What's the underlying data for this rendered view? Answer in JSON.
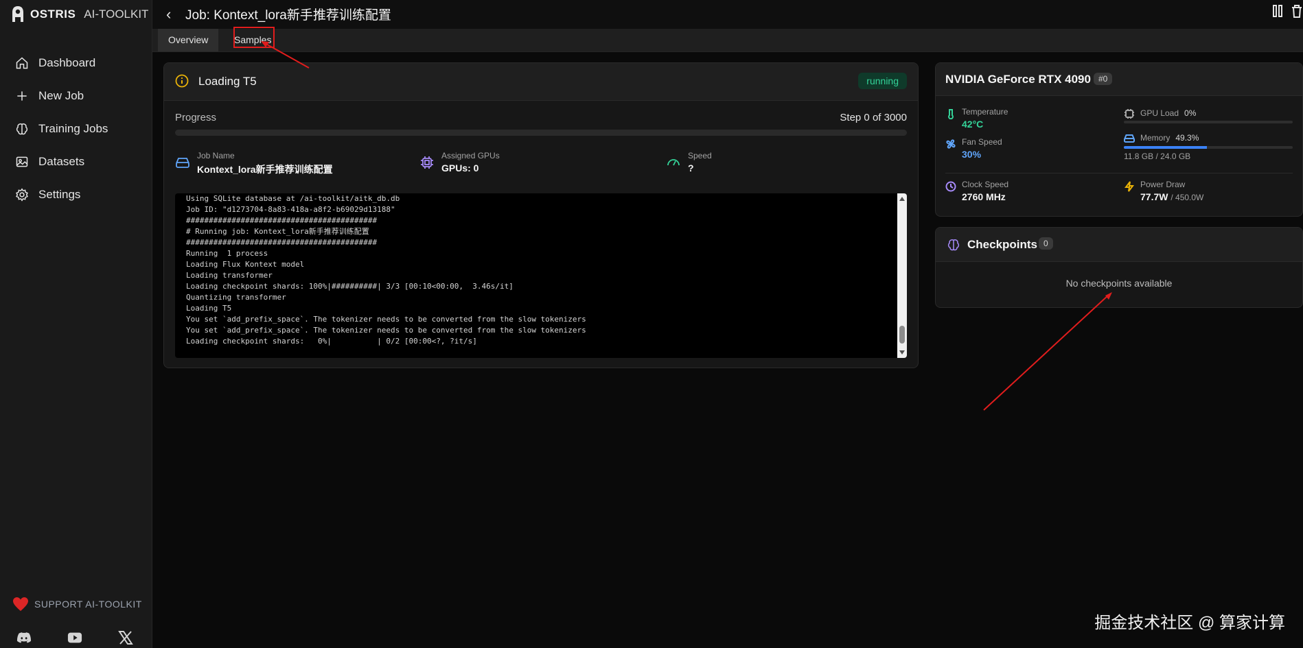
{
  "app": {
    "brand_name": "OSTRIS",
    "brand_sub": "AI-TOOLKIT"
  },
  "sidebar": {
    "items": [
      {
        "label": "Dashboard",
        "icon": "home-icon"
      },
      {
        "label": "New Job",
        "icon": "plus-icon"
      },
      {
        "label": "Training Jobs",
        "icon": "brain-icon"
      },
      {
        "label": "Datasets",
        "icon": "image-icon"
      },
      {
        "label": "Settings",
        "icon": "gear-icon"
      }
    ],
    "support_label": "SUPPORT AI-TOOLKIT"
  },
  "header": {
    "title": "Job: Kontext_lora新手推荐训练配置"
  },
  "tabs": [
    {
      "label": "Overview",
      "active": true
    },
    {
      "label": "Samples",
      "active": false
    }
  ],
  "status": {
    "title": "Loading T5",
    "badge": "running"
  },
  "progress": {
    "label": "Progress",
    "step_text": "Step 0 of 3000",
    "fraction": 0
  },
  "info": {
    "job_name_label": "Job Name",
    "job_name_value": "Kontext_lora新手推荐训练配置",
    "gpus_label": "Assigned GPUs",
    "gpus_value": "GPUs: 0",
    "speed_label": "Speed",
    "speed_value": "?"
  },
  "log": [
    "Using SQLite database at /ai-toolkit/aitk_db.db",
    "Job ID: \"d1273704-8a83-418a-a8f2-b69029d13188\"",
    "##########################################",
    "# Running job: Kontext_lora新手推荐训练配置",
    "##########################################",
    "Running  1 process",
    "Loading Flux Kontext model",
    "Loading transformer",
    "Loading checkpoint shards: 100%|##########| 3/3 [00:10<00:00,  3.46s/it]",
    "Quantizing transformer",
    "Loading T5",
    "You set `add_prefix_space`. The tokenizer needs to be converted from the slow tokenizers",
    "You set `add_prefix_space`. The tokenizer needs to be converted from the slow tokenizers",
    "Loading checkpoint shards:   0%|          | 0/2 [00:00<?, ?it/s]"
  ],
  "gpu": {
    "name": "NVIDIA GeForce RTX 4090",
    "badge": "#0",
    "temperature_label": "Temperature",
    "temperature_value": "42°C",
    "gpu_load_label": "GPU Load",
    "gpu_load_value": "0%",
    "gpu_load_fraction": 0,
    "fan_label": "Fan Speed",
    "fan_value": "30%",
    "memory_label": "Memory",
    "memory_value": "49.3%",
    "memory_fraction": 0.493,
    "memory_detail": "11.8 GB / 24.0 GB",
    "clock_label": "Clock Speed",
    "clock_value": "2760 MHz",
    "power_label": "Power Draw",
    "power_value": "77.7W",
    "power_limit": "/ 450.0W"
  },
  "checkpoints": {
    "title": "Checkpoints",
    "count": "0",
    "empty_text": "No checkpoints available"
  },
  "watermark": "掘金技术社区 @ 算家计算",
  "colors": {
    "accent": "#3b82f6",
    "running": "#34d399",
    "temperature": "#34d399",
    "fan": "#60a5fa",
    "annotation": "#e11d1d"
  }
}
